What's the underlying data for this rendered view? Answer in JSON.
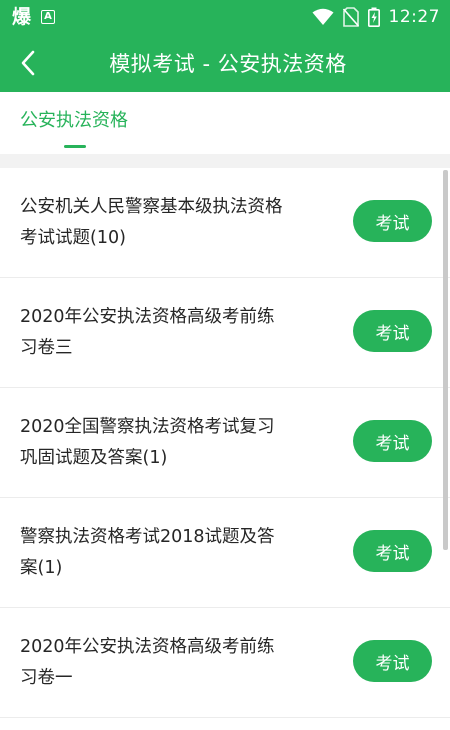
{
  "status_bar": {
    "app_icon_text": "爆",
    "notification_badge": "A",
    "time": "12:27"
  },
  "toolbar": {
    "title": "模拟考试 - 公安执法资格"
  },
  "tabs": [
    {
      "label": "公安执法资格"
    }
  ],
  "exam_list": [
    {
      "title": "公安机关人民警察基本级执法资格考试试题(10)",
      "button": "考试"
    },
    {
      "title": "2020年公安执法资格高级考前练习卷三",
      "button": "考试"
    },
    {
      "title": "2020全国警察执法资格考试复习巩固试题及答案(1)",
      "button": "考试"
    },
    {
      "title": "警察执法资格考试2018试题及答案(1)",
      "button": "考试"
    },
    {
      "title": "2020年公安执法资格高级考前练习卷一",
      "button": "考试"
    }
  ],
  "colors": {
    "primary": "#27b35a",
    "divider": "#f2f2f2"
  }
}
